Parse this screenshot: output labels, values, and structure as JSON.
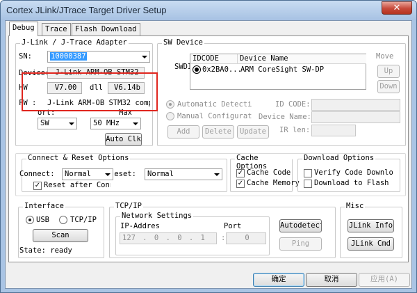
{
  "window": {
    "title": "Cortex JLink/JTrace Target Driver Setup",
    "close": "✕"
  },
  "tabs": [
    {
      "label": "Debug"
    },
    {
      "label": "Trace"
    },
    {
      "label": "Flash Download"
    }
  ],
  "jlink": {
    "group_label": "J-Link / J-Trace Adapter",
    "sn_label": "SN:",
    "sn_value": "10000387",
    "device_label": "Device:",
    "device_value": "J-Link ARM-OB STM32",
    "hw_label": "HW",
    "hw_value": "V7.00",
    "dll_label": "dll",
    "dll_value": "V6.14b",
    "fw_label": "FW :",
    "fw_value": "J-Link ARM-OB STM32 comp",
    "port_label": "ort:",
    "port_value": "SW",
    "max_label": "Max",
    "max_value": "50 MHz",
    "autoclk_label": "Auto Clk"
  },
  "swdevice": {
    "group_label": "SW Device",
    "swdio_label": "SWDI(",
    "col_idcode": "IDCODE",
    "col_name": "Device Name",
    "row_idcode": "0x2BA0...",
    "row_name": "ARM CoreSight SW-DP",
    "move_label": "Move",
    "up_label": "Up",
    "down_label": "Down",
    "auto_detect_label": "Automatic Detectic",
    "manual_config_label": "Manual Configurati",
    "id_code_label": "ID CODE:",
    "device_name_label": "Device Name:",
    "ir_len_label": "IR len:",
    "add_label": "Add",
    "delete_label": "Delete",
    "update_label": "Update"
  },
  "connect": {
    "group_label": "Connect & Reset Options",
    "connect_label": "Connect:",
    "connect_value": "Normal",
    "reset_label": "Reset:",
    "reset_value": "Normal",
    "reset_after_label": "Reset after Conn"
  },
  "cache": {
    "group_label": "Cache Options",
    "code_label": "Cache Code",
    "memory_label": "Cache Memory"
  },
  "download": {
    "group_label": "Download Options",
    "verify_label": "Verify Code Downlo",
    "flash_label": "Download to Flash"
  },
  "interface": {
    "group_label": "Interface",
    "usb_label": "USB",
    "tcpip_label": "TCP/IP",
    "scan_label": "Scan",
    "state_label": "State: ready"
  },
  "tcpip": {
    "group_label": "TCP/IP",
    "network_label": "Network Settings",
    "ip_label": "IP-Addres",
    "port_label": "Port",
    "ip_value": "127 . 0 . 0 . 1",
    "port_value": "0",
    "colon": ":",
    "autodetect_label": "Autodetect",
    "ping_label": "Ping"
  },
  "misc": {
    "group_label": "Misc",
    "jlink_info_label": "JLink Info",
    "jlink_cmd_label": "JLink Cmd"
  },
  "footer": {
    "ok_label": "确定",
    "cancel_label": "取消",
    "apply_label": "应用(A)"
  }
}
